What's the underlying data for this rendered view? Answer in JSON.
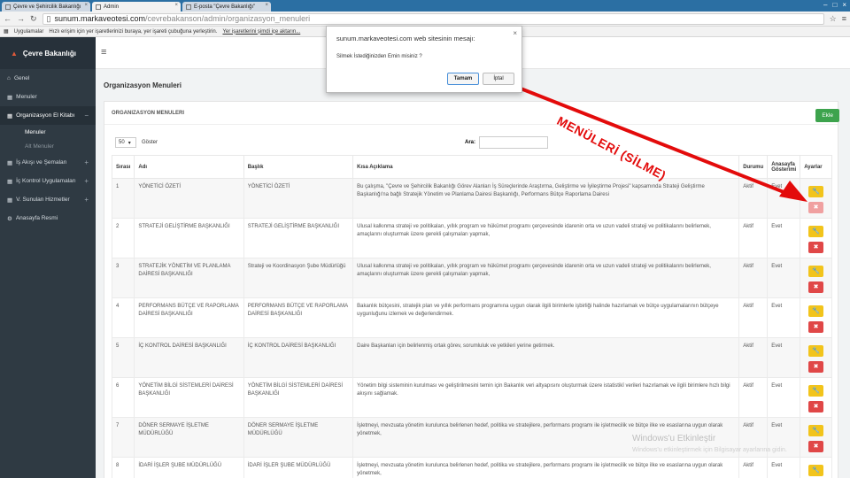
{
  "tabs": [
    {
      "label": "Çevre ve Şehircilik Bakanlığı"
    },
    {
      "label": "Admin"
    },
    {
      "label": "E-posta \"Çevre Bakanlığı\""
    }
  ],
  "address": {
    "domain": "sunum.markaveotesi.com",
    "path": "/cevrebakanson/admin/organizasyon_menuleri"
  },
  "bookmarks": {
    "apps": "Uygulamalar",
    "hint": "Hızlı erişim için yer işaretlerinizi buraya, yer işareti çubuğuna yerleştirin.",
    "link": "Yer işaretlerini şimdi içe aktarın..."
  },
  "sidebar": {
    "brand": "Çevre Bakanlığı",
    "items": [
      {
        "label": "Genel"
      },
      {
        "label": "Menuler"
      },
      {
        "label": "Organizasyon El Kitabı"
      },
      {
        "label": "İş Akışı ve Şemaları"
      },
      {
        "label": "İç Kontrol Uygulamaları"
      },
      {
        "label": "V. Sunulan Hizmetler"
      },
      {
        "label": "Anasayfa Resmi"
      }
    ],
    "subitems": [
      {
        "label": "Menuler"
      },
      {
        "label": "Alt Menuler"
      }
    ]
  },
  "page": {
    "title": "Organizasyon Menuleri",
    "panel_title": "ORGANIZASYON MENULERI",
    "add_button": "Ekle",
    "page_size": "50",
    "show_label": "Göster",
    "search_label": "Ara:"
  },
  "table": {
    "headers": [
      "Sırası",
      "Adı",
      "Başlık",
      "Kısa Açıklama",
      "Durumu",
      "Anasayfa Gösterimi",
      "Ayarlar"
    ],
    "rows": [
      {
        "no": "1",
        "name": "YÖNETİCİ ÖZETİ",
        "title": "YÖNETİCİ ÖZETİ",
        "desc": "Bu çalışma, \"Çevre ve Şehircilik Bakanlığı Görev Alanları İş Süreçlerinde Araştırma, Geliştirme ve İyileştirme Projesi\" kapsamında Strateji Geliştirme Başkanlığı'na bağlı Stratejik Yönetim ve Planlama Dairesi Başkanlığı, Performans Bütçe Raporlama Dairesi",
        "status": "Aktif",
        "home": "Evet"
      },
      {
        "no": "2",
        "name": "STRATEJİ GELİŞTİRME BAŞKANLIĞI",
        "title": "STRATEJİ GELİŞTİRME BAŞKANLIĞI",
        "desc": "Ulusal kalkınma strateji ve politikaları, yıllık program ve hükümet programı çerçevesinde idarenin orta ve uzun vadeli strateji ve politikalarını belirlemek, amaçlarını oluşturmak üzere gerekli çalışmaları yapmak,",
        "status": "Aktif",
        "home": "Evet"
      },
      {
        "no": "3",
        "name": "STRATEJİK YÖNETİM VE PLANLAMA DAİRESİ BAŞKANLIĞI",
        "title": "Strateji ve Koordinasyon Şube Müdürlüğü",
        "desc": "Ulusal kalkınma strateji ve politikaları, yıllık program ve hükümet programı çerçevesinde idarenin orta ve uzun vadeli strateji ve politikalarını belirlemek, amaçlarını oluşturmak üzere gerekli çalışmaları yapmak,",
        "status": "Aktif",
        "home": "Evet"
      },
      {
        "no": "4",
        "name": "PERFORMANS BÜTÇE VE RAPORLAMA DAİRESİ BAŞKANLIĞI",
        "title": "PERFORMANS BÜTÇE VE RAPORLAMA DAİRESİ BAŞKANLIĞI",
        "desc": "Bakanlık bütçesini, stratejik plan ve yıllık performans programına uygun olarak ilgili birimlerle işbirliği halinde hazırlamak ve bütçe uygulamalarının bütçeye uygunluğunu izlemek ve değerlendirmek.",
        "status": "Aktif",
        "home": "Evet"
      },
      {
        "no": "5",
        "name": "İÇ KONTROL DAİRESİ BAŞKANLIĞI",
        "title": "İÇ KONTROL DAİRESİ BAŞKANLIĞI",
        "desc": "Daire Başkanları için belirlenmiş ortak görev, sorumluluk ve yetkileri yerine getirmek.",
        "status": "Aktif",
        "home": "Evet"
      },
      {
        "no": "6",
        "name": "YÖNETİM BİLGİ SİSTEMLERİ DAİRESİ BAŞKANLIĞI",
        "title": "YÖNETİM BİLGİ SİSTEMLERİ DAİRESİ BAŞKANLIĞI",
        "desc": "Yönetim bilgi sisteminin kurulması ve geliştirilmesini temin için Bakanlık veri altyapısını oluşturmak üzere istatistikî verileri hazırlamak ve ilgili birimlere hızlı bilgi akışını sağlamak.",
        "status": "Aktif",
        "home": "Evet"
      },
      {
        "no": "7",
        "name": "DÖNER SERMAYE İŞLETME MÜDÜRLÜĞÜ",
        "title": "DÖNER SERMAYE İŞLETME MÜDÜRLÜĞÜ",
        "desc": "İşletmeyi, mevzuata yönetim kurulunca belirlenen hedef, politika ve stratejilere, performans programı ile işletmecilik ve bütçe ilke ve esaslarına uygun olarak yönetmek,",
        "status": "Aktif",
        "home": "Evet"
      },
      {
        "no": "8",
        "name": "İDARİ İŞLER ŞUBE MÜDÜRLÜĞÜ",
        "title": "İDARİ İŞLER ŞUBE MÜDÜRLÜĞÜ",
        "desc": "İşletmeyi, mevzuata yönetim kurulunca belirlenen hedef, politika ve stratejilere, performans programı ile işletmecilik ve bütçe ilke ve esaslarına uygun olarak yönetmek,",
        "status": "Aktif",
        "home": "Evet"
      }
    ]
  },
  "dialog": {
    "title": "sunum.markaveotesi.com web sitesinin mesajı:",
    "message": "Silmek İstediğinizden Emin misiniz ?",
    "ok": "Tamam",
    "cancel": "İptal"
  },
  "annotation": "MENÜLERİ (SİLME)",
  "watermark": {
    "title": "Windows'u Etkinleştir",
    "subtitle": "Windows'u etkinleştirmek için Bilgisayar ayarlarına gidin."
  },
  "colors": {
    "sidebar": "#2f3a43",
    "add": "#3da34d",
    "edit": "#f2c41b",
    "delete": "#e04747",
    "annotation": "#e30b0b"
  }
}
